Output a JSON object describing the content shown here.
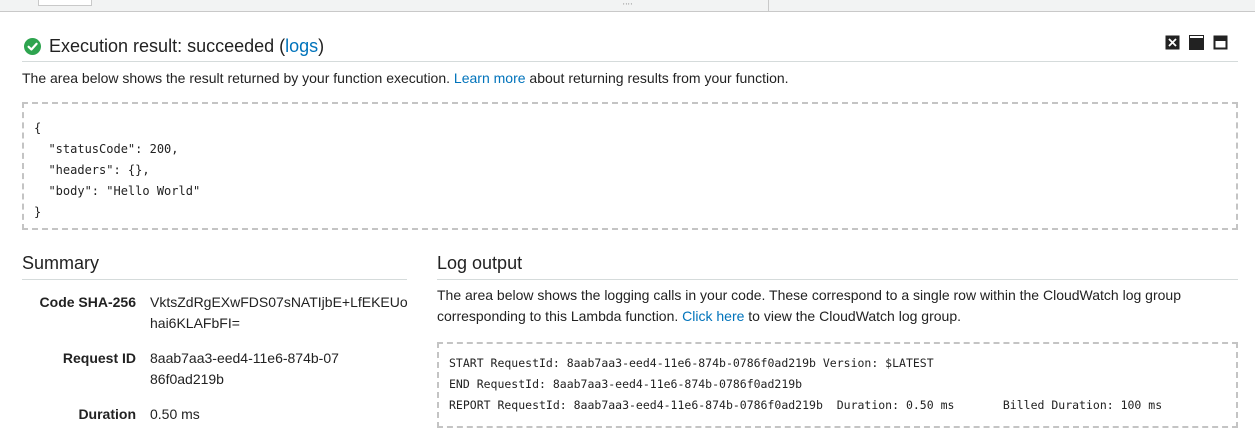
{
  "header": {
    "title_prefix": "Execution result: succeeded (",
    "logs_link": "logs",
    "title_suffix": ")"
  },
  "result_description": {
    "before": "The area below shows the result returned by your function execution. ",
    "link": "Learn more",
    "after": " about returning results from your function."
  },
  "result_body": "{\n  \"statusCode\": 200,\n  \"headers\": {},\n  \"body\": \"Hello World\"\n}",
  "summary": {
    "title": "Summary",
    "rows": [
      {
        "label": "Code SHA-256",
        "value": "VktsZdRgEXwFDS07sNATIjbE+LfEKEUohai6KLAFbFI="
      },
      {
        "label": "Request ID",
        "value": "8aab7aa3-eed4-11e6-874b-0786f0ad219b"
      },
      {
        "label": "Duration",
        "value": "0.50 ms"
      }
    ]
  },
  "log_output": {
    "title": "Log output",
    "desc_before": "The area below shows the logging calls in your code. These correspond to a single row within the CloudWatch log group corresponding to this Lambda function. ",
    "desc_link": "Click here",
    "desc_after": " to view the CloudWatch log group.",
    "lines": [
      "START RequestId: 8aab7aa3-eed4-11e6-874b-0786f0ad219b Version: $LATEST",
      "END RequestId: 8aab7aa3-eed4-11e6-874b-0786f0ad219b",
      "REPORT RequestId: 8aab7aa3-eed4-11e6-874b-0786f0ad219b  Duration: 0.50 ms       Billed Duration: 100 ms"
    ]
  },
  "colors": {
    "success": "#2ea44f",
    "link": "#0073bb"
  },
  "icons": [
    "check-circle-icon",
    "close-icon",
    "minimize-icon",
    "maximize-icon"
  ]
}
